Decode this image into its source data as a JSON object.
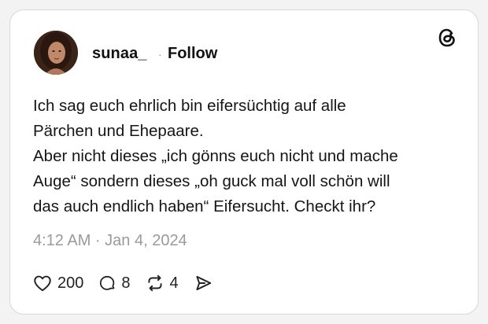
{
  "post": {
    "username": "sunaa_",
    "separator": "·",
    "follow_label": "Follow",
    "text_lines": [
      "Ich sag euch ehrlich bin eifersüchtig auf alle",
      "Pärchen und Ehepaare.",
      "Aber nicht dieses „ich gönns euch nicht und mache",
      "Auge“ sondern dieses „oh guck mal voll schön will",
      "das auch endlich haben“ Eifersucht. Checkt ihr?"
    ],
    "timestamp": "4:12 AM · Jan 4, 2024"
  },
  "actions": {
    "likes": "200",
    "replies": "8",
    "reposts": "4"
  },
  "icons": {
    "brand": "threads-logo-icon",
    "like": "heart-icon",
    "reply": "comment-bubble-icon",
    "repost": "repost-arrows-icon",
    "share": "send-arrow-icon"
  },
  "colors": {
    "card_background": "#ffffff",
    "text": "#111111",
    "muted_text": "#9a9a9a",
    "border": "#d7d7d7"
  }
}
